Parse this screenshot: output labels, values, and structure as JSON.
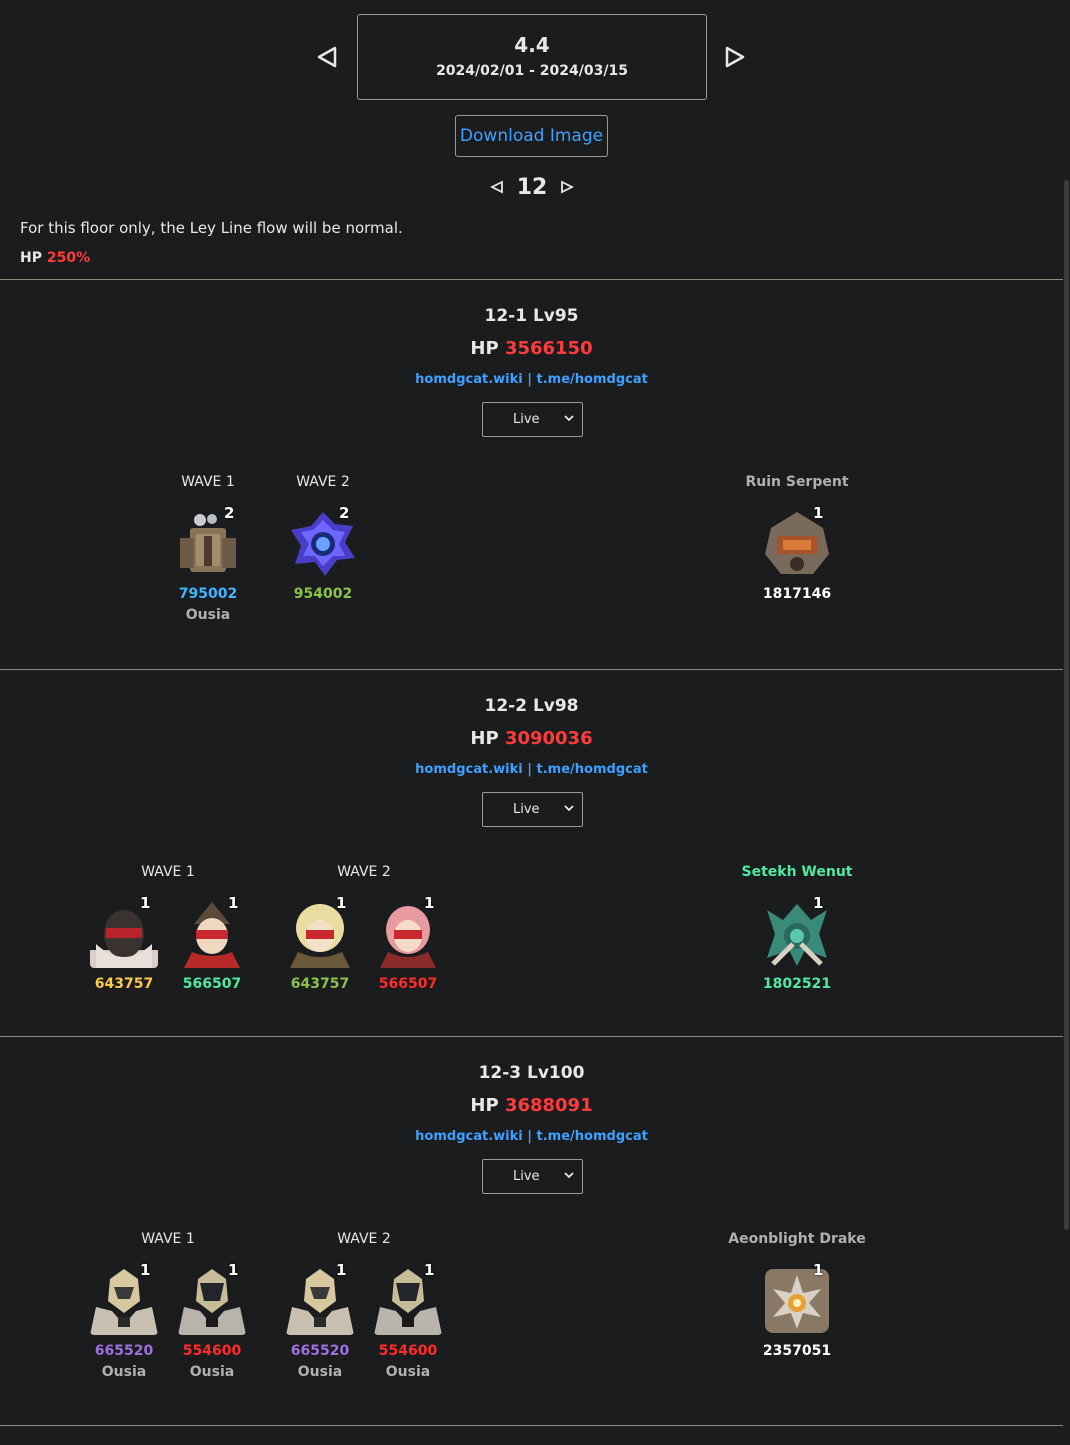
{
  "version": {
    "number": "4.4",
    "dates": "2024/02/01 - 2024/03/15"
  },
  "download_label": "Download Image",
  "floor": {
    "number": "12",
    "leyline": "For this floor only, the Ley Line flow will be normal.",
    "hp_label": "HP",
    "hp_value": "250%"
  },
  "colors": {
    "accent_blue": "#3fa0ff",
    "hp_red": "#ff3b3b",
    "cyan": "#3fb6ff",
    "green": "#8bc34a",
    "mint": "#4eeaa0",
    "yellow": "#ffc94a",
    "purple": "#a070e0",
    "red": "#ff2b2b",
    "white": "#ffffff"
  },
  "chambers": [
    {
      "title": "12-1 Lv95",
      "hp_label": "HP",
      "hp_value": "3566150",
      "links": "homdgcat.wiki | t.me/homdgcat",
      "select_value": "Live",
      "wave1_label": "WAVE 1",
      "wave2_label": "WAVE 2",
      "boss_label": "Ruin Serpent",
      "wave1": [
        {
          "icon": "ruin-machine-icon",
          "count": "2",
          "hp": "795002",
          "hp_color": "#3fb6ff",
          "tag": "Ousia"
        }
      ],
      "wave2": [
        {
          "icon": "abyss-lector-orb-icon",
          "count": "2",
          "hp": "954002",
          "hp_color": "#8bc34a",
          "tag": ""
        }
      ],
      "boss": [
        {
          "icon": "ruin-serpent-icon",
          "count": "1",
          "hp": "1817146",
          "hp_color": "#ffffff",
          "tag": ""
        }
      ]
    },
    {
      "title": "12-2 Lv98",
      "hp_label": "HP",
      "hp_value": "3090036",
      "links": "homdgcat.wiki | t.me/homdgcat",
      "select_value": "Live",
      "wave1_label": "WAVE 1",
      "wave2_label": "WAVE 2",
      "boss_label": "Setekh Wenut",
      "wave1": [
        {
          "icon": "eremite-masked-icon",
          "count": "1",
          "hp": "643757",
          "hp_color": "#ffc94a",
          "tag": ""
        },
        {
          "icon": "eremite-dancer-icon",
          "count": "1",
          "hp": "566507",
          "hp_color": "#4eeaa0",
          "tag": ""
        }
      ],
      "wave2": [
        {
          "icon": "eremite-blonde-icon",
          "count": "1",
          "hp": "643757",
          "hp_color": "#8bc34a",
          "tag": ""
        },
        {
          "icon": "eremite-pink-icon",
          "count": "1",
          "hp": "566507",
          "hp_color": "#ff2b2b",
          "tag": ""
        }
      ],
      "boss": [
        {
          "icon": "setekh-wenut-icon",
          "count": "1",
          "hp": "1802521",
          "hp_color": "#4eeaa0",
          "tag": ""
        }
      ]
    },
    {
      "title": "12-3 Lv100",
      "hp_label": "HP",
      "hp_value": "3688091",
      "links": "homdgcat.wiki | t.me/homdgcat",
      "select_value": "Live",
      "wave1_label": "WAVE 1",
      "wave2_label": "WAVE 2",
      "boss_label": "Aeonblight Drake",
      "wave1": [
        {
          "icon": "mech-gold-icon",
          "count": "1",
          "hp": "665520",
          "hp_color": "#a070e0",
          "tag": "Ousia"
        },
        {
          "icon": "mech-dark-icon",
          "count": "1",
          "hp": "554600",
          "hp_color": "#ff2b2b",
          "tag": "Ousia"
        }
      ],
      "wave2": [
        {
          "icon": "mech-gold-icon",
          "count": "1",
          "hp": "665520",
          "hp_color": "#a070e0",
          "tag": "Ousia"
        },
        {
          "icon": "mech-dark-icon",
          "count": "1",
          "hp": "554600",
          "hp_color": "#ff2b2b",
          "tag": "Ousia"
        }
      ],
      "boss": [
        {
          "icon": "aeonblight-drake-icon",
          "count": "1",
          "hp": "2357051",
          "hp_color": "#ffffff",
          "tag": ""
        }
      ]
    }
  ]
}
